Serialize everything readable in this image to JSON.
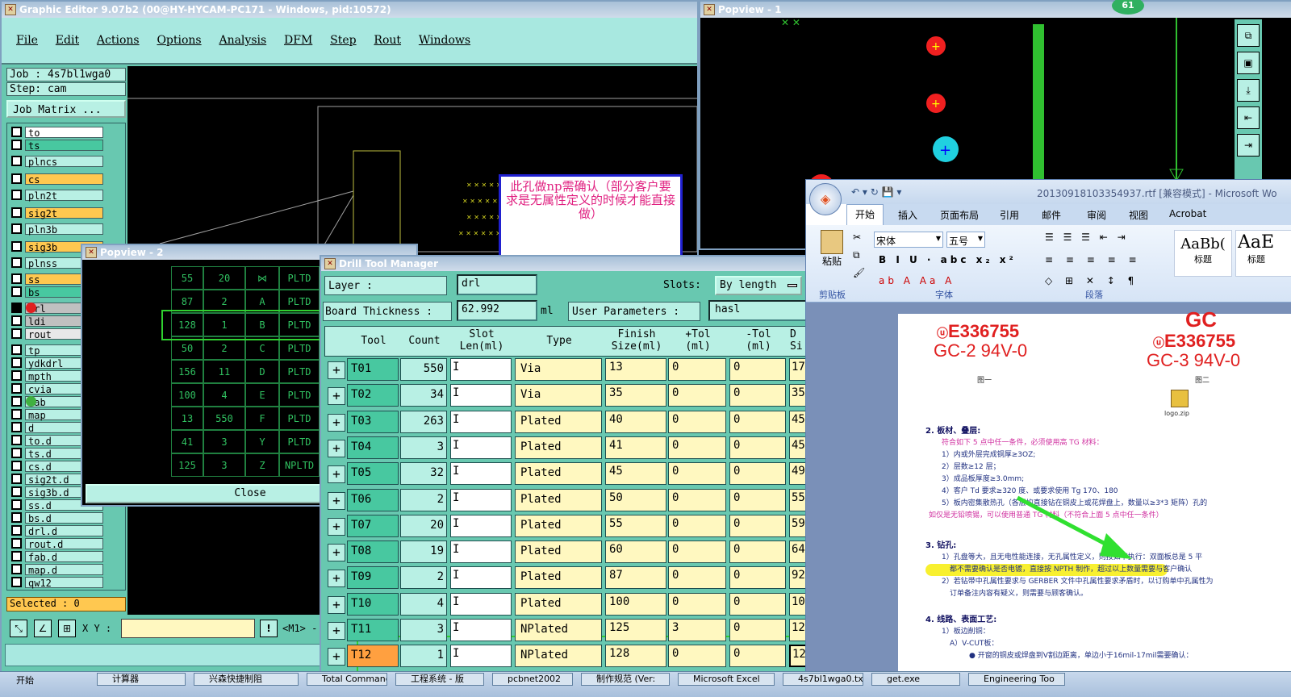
{
  "main_window": {
    "title": "Graphic Editor 9.07b2 (00@HY-HYCAM-PC171 - Windows, pid:10572)",
    "menu": [
      "File",
      "Edit",
      "Actions",
      "Options",
      "Analysis",
      "DFM",
      "Step",
      "Rout",
      "Windows"
    ],
    "job_label": "Job : 4s7bl1wga0",
    "step_label": "Step: cam",
    "job_matrix_button": "Job Matrix ...",
    "layers": [
      {
        "name": "to",
        "color": "#ffffff"
      },
      {
        "name": "ts",
        "color": "#48c8a0"
      },
      {
        "name": "plncs",
        "color": "#b8f0e4"
      },
      {
        "name": "cs",
        "color": "#ffc850"
      },
      {
        "name": "pln2t",
        "color": "#b8f0e4"
      },
      {
        "name": "sig2t",
        "color": "#ffc850"
      },
      {
        "name": "pln3b",
        "color": "#b8f0e4"
      },
      {
        "name": "sig3b",
        "color": "#ffc850"
      },
      {
        "name": "plnss",
        "color": "#b8f0e4"
      },
      {
        "name": "ss",
        "color": "#ffc850"
      },
      {
        "name": "bs",
        "color": "#48c8a0"
      },
      {
        "name": "drl",
        "color": "#c0c0c0"
      },
      {
        "name": "ldi",
        "color": "#c0c0c0"
      },
      {
        "name": "rout",
        "color": "#e8e8e8"
      },
      {
        "name": "tp",
        "color": "#b8f0e4"
      },
      {
        "name": "ydkdrl",
        "color": "#b8f0e4"
      },
      {
        "name": "mpth",
        "color": "#b8f0e4"
      },
      {
        "name": "cvia",
        "color": "#b8f0e4"
      },
      {
        "name": "fab",
        "color": "#b8f0e4"
      },
      {
        "name": "map",
        "color": "#b8f0e4"
      },
      {
        "name": "d",
        "color": "#b8f0e4"
      },
      {
        "name": "to.d",
        "color": "#b8f0e4"
      },
      {
        "name": "ts.d",
        "color": "#b8f0e4"
      },
      {
        "name": "cs.d",
        "color": "#b8f0e4"
      },
      {
        "name": "sig2t.d",
        "color": "#b8f0e4"
      },
      {
        "name": "sig3b.d",
        "color": "#b8f0e4"
      },
      {
        "name": "ss.d",
        "color": "#b8f0e4"
      },
      {
        "name": "bs.d",
        "color": "#b8f0e4"
      },
      {
        "name": "drl.d",
        "color": "#b8f0e4"
      },
      {
        "name": "rout.d",
        "color": "#b8f0e4"
      },
      {
        "name": "fab.d",
        "color": "#b8f0e4"
      },
      {
        "name": "map.d",
        "color": "#b8f0e4"
      },
      {
        "name": "qw12",
        "color": "#b8f0e4"
      }
    ],
    "selected_label": "Selected : 0",
    "xy_label": "X Y :",
    "m1_label": "<M1> -",
    "excl_label": "!"
  },
  "popview1": {
    "title": "Popview - 1",
    "badge": "61"
  },
  "popview2": {
    "title": "Popview - 2",
    "rows": [
      [
        "55",
        "20",
        "⋈",
        "PLTD"
      ],
      [
        "87",
        "2",
        "A",
        "PLTD"
      ],
      [
        "128",
        "1",
        "B",
        "PLTD"
      ],
      [
        "50",
        "2",
        "C",
        "PLTD"
      ],
      [
        "156",
        "11",
        "D",
        "PLTD"
      ],
      [
        "100",
        "4",
        "E",
        "PLTD"
      ],
      [
        "13",
        "550",
        "F",
        "PLTD"
      ],
      [
        "41",
        "3",
        "Y",
        "PLTD"
      ],
      [
        "125",
        "3",
        "Z",
        "NPLTD"
      ]
    ],
    "close_label": "Close"
  },
  "annotation_note": "此孔做np需确认（部分客户要求是无属性定义的时候才能直接做）",
  "drill_manager": {
    "title": "Drill Tool Manager",
    "layer_label": "Layer :",
    "layer_value": "drl",
    "slots_label": "Slots:",
    "slots_value": "By length",
    "board_thickness_label": "Board Thickness :",
    "board_thickness_value": "62.992",
    "board_thickness_unit": "ml",
    "user_params_label": "User Parameters :",
    "user_params_value": "hasl",
    "headers": [
      "Tool",
      "Count",
      "Slot Len(ml)",
      "Type",
      "Finish Size(ml)",
      "+Tol (ml)",
      "-Tol (ml)",
      "D Si"
    ],
    "tools": [
      {
        "tool": "T01",
        "count": "550",
        "type": "Via",
        "finish": "13",
        "ptol": "0",
        "mtol": "0",
        "d": "17"
      },
      {
        "tool": "T02",
        "count": "34",
        "type": "Via",
        "finish": "35",
        "ptol": "0",
        "mtol": "0",
        "d": "35"
      },
      {
        "tool": "T03",
        "count": "263",
        "type": "Plated",
        "finish": "40",
        "ptol": "0",
        "mtol": "0",
        "d": "45"
      },
      {
        "tool": "T04",
        "count": "3",
        "type": "Plated",
        "finish": "41",
        "ptol": "0",
        "mtol": "0",
        "d": "45"
      },
      {
        "tool": "T05",
        "count": "32",
        "type": "Plated",
        "finish": "45",
        "ptol": "0",
        "mtol": "0",
        "d": "49"
      },
      {
        "tool": "T06",
        "count": "2",
        "type": "Plated",
        "finish": "50",
        "ptol": "0",
        "mtol": "0",
        "d": "55"
      },
      {
        "tool": "T07",
        "count": "20",
        "type": "Plated",
        "finish": "55",
        "ptol": "0",
        "mtol": "0",
        "d": "59"
      },
      {
        "tool": "T08",
        "count": "19",
        "type": "Plated",
        "finish": "60",
        "ptol": "0",
        "mtol": "0",
        "d": "64"
      },
      {
        "tool": "T09",
        "count": "2",
        "type": "Plated",
        "finish": "87",
        "ptol": "0",
        "mtol": "0",
        "d": "92"
      },
      {
        "tool": "T10",
        "count": "4",
        "type": "Plated",
        "finish": "100",
        "ptol": "0",
        "mtol": "0",
        "d": "10"
      },
      {
        "tool": "T11",
        "count": "3",
        "type": "NPlated",
        "finish": "125",
        "ptol": "3",
        "mtol": "0",
        "d": "12"
      },
      {
        "tool": "T12",
        "count": "1",
        "type": "NPlated",
        "finish": "128",
        "ptol": "0",
        "mtol": "0",
        "d": "12"
      }
    ]
  },
  "word": {
    "title": "20130918103354937.rtf [兼容模式] - Microsoft Wo",
    "tabs": [
      "开始",
      "插入",
      "页面布局",
      "引用",
      "邮件",
      "审阅",
      "视图",
      "Acrobat"
    ],
    "font_name": "宋体",
    "font_size": "五号",
    "paste_label": "粘贴",
    "groups": [
      "剪贴板",
      "字体",
      "段落"
    ],
    "style1": "AaBb(",
    "style1_label": "标题",
    "style2": "AaE",
    "style2_label": "标题",
    "doc": {
      "logo1_line1": "E336755",
      "logo1_line2": "GC-2 94V-0",
      "logo2_top": "GC",
      "logo2_line1": "E336755",
      "logo2_line2": "GC-3 94V-0",
      "fig1": "图一",
      "fig2": "图二",
      "logo_file": "logo.zip",
      "sec2_title": "2.   板材、叠层:",
      "sec2_red": "符合如下 5 点中任一条件，必须使用高 TG 材料：",
      "sec2_items": [
        "1）内或外层完成铜厚≥3OZ;",
        "2）层数≥12 层；",
        "3）成品板厚度≥3.0mm;",
        "4）客户 Td 要求≥320 度、或要求使用 Tg 170、180",
        "5）板内密集散热孔（各层均直接钻在铜皮上或花焊盘上，数量以≥3*3 矩阵）孔的"
      ],
      "sec2_red2": "如仅是无铅喷锡，可以使用普通 TG 材料（不符合上面 5 点中任一条件）",
      "sec3_title": "3.   钻孔:",
      "sec3_items": [
        "1）孔盘等大，且无电性能连接，无孔属性定义，则按如下执行：双面板总是 5 平",
        "都不需要确认是否电镀，直接按 NPTH 制作，超过以上数量需要与客户确认",
        "2）若钻带中孔属性要求与 GERBER 文件中孔属性要求矛盾时，以订购单中孔属性为",
        "订单备注内容有疑义，则需要与顾客确认。"
      ],
      "sec4_title": "4.   线路、表面工艺:",
      "sec4_items": [
        "1）板边削铜：",
        "A）V-CUT板：",
        "●   开窗的铜皮或焊盘到V割边距离，单边小于16mil-17mil需要确认："
      ]
    }
  },
  "taskbar": {
    "start": "开始",
    "items": [
      "计算器",
      "兴森快捷制阻",
      "Total Command",
      "工程系统 - 版",
      "pcbnet2002",
      "制作规范 (Ver:",
      "Microsoft Excel",
      "4s7bl1wga0.txt",
      "get.exe",
      "Engineering Too"
    ]
  }
}
